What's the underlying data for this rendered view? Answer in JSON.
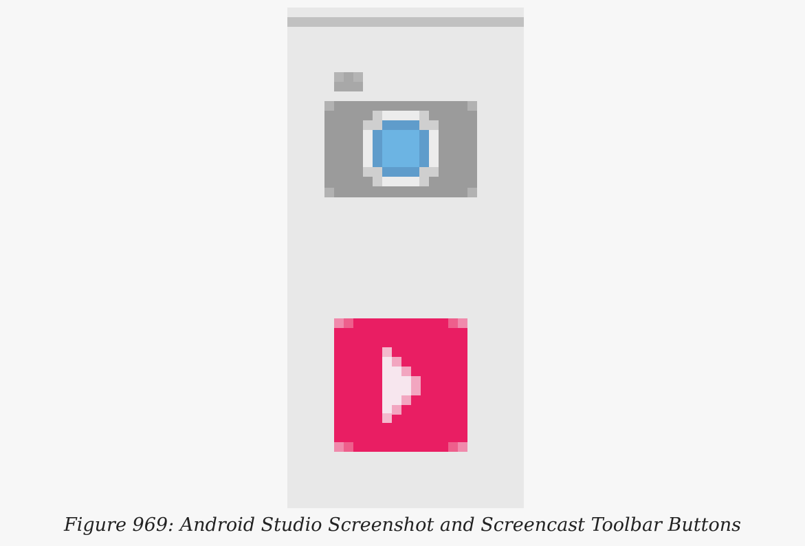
{
  "colors": {
    "page_background": "#f7f7f7",
    "toolbar_background": "#e8e8e8",
    "toolbar_top_edge": "#c1c1c1",
    "camera_body": "#9b9b9b",
    "camera_lens": "#6cb4e3",
    "screencast_button": "#e91e63",
    "play_glyph": "#f7e6ee"
  },
  "toolbar": {
    "buttons": [
      {
        "name": "screenshot",
        "icon": "camera-icon"
      },
      {
        "name": "screencast",
        "icon": "play-icon"
      }
    ]
  },
  "caption": "Figure 969: Android Studio Screenshot and Screencast Toolbar Buttons"
}
